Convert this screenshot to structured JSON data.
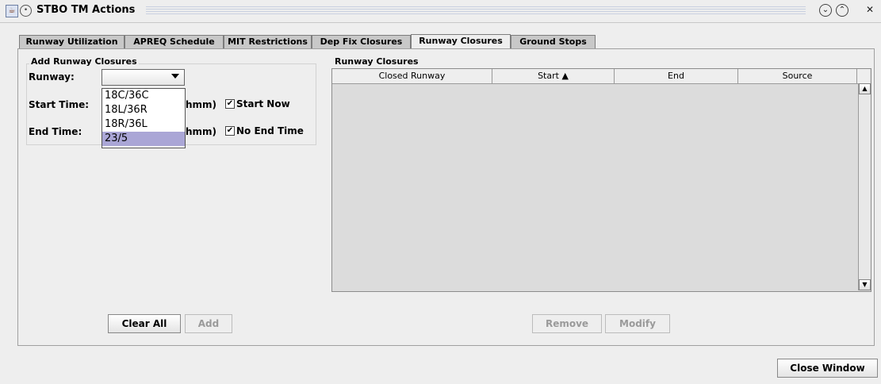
{
  "window": {
    "title": "STBO TM Actions"
  },
  "tabs": [
    {
      "label": "Runway Utilization"
    },
    {
      "label": "APREQ Schedule"
    },
    {
      "label": "MIT Restrictions"
    },
    {
      "label": "Dep Fix Closures"
    },
    {
      "label": "Runway Closures",
      "active": true
    },
    {
      "label": "Ground Stops"
    }
  ],
  "add_group": {
    "title": "Add Runway Closures",
    "runway_label": "Runway:",
    "runway_value": "",
    "start_label": "Start Time:",
    "start_hint": "hmm)",
    "start_now_label": "Start Now",
    "start_now_checked": true,
    "end_label": "End Time:",
    "end_hint": "hmm)",
    "no_end_label": "No End Time",
    "no_end_checked": true,
    "runway_options": [
      "18C/36C",
      "18L/36R",
      "18R/36L",
      "23/5"
    ],
    "runway_highlighted": "23/5"
  },
  "closures_group": {
    "title": "Runway Closures",
    "columns": [
      "Closed Runway",
      "Start ▲",
      "End",
      "Source"
    ],
    "rows": []
  },
  "buttons": {
    "clear_all": "Clear All",
    "add": "Add",
    "remove": "Remove",
    "modify": "Modify",
    "close_window": "Close Window"
  },
  "icons": {
    "app": "java-app-icon",
    "menu": "window-menu-icon",
    "minimize": "minimize-icon",
    "maximize": "maximize-icon",
    "close": "close-icon"
  },
  "colors": {
    "selection": "#aaa6d6",
    "tab_inactive": "#c8c8c8",
    "background": "#eeeeee"
  }
}
